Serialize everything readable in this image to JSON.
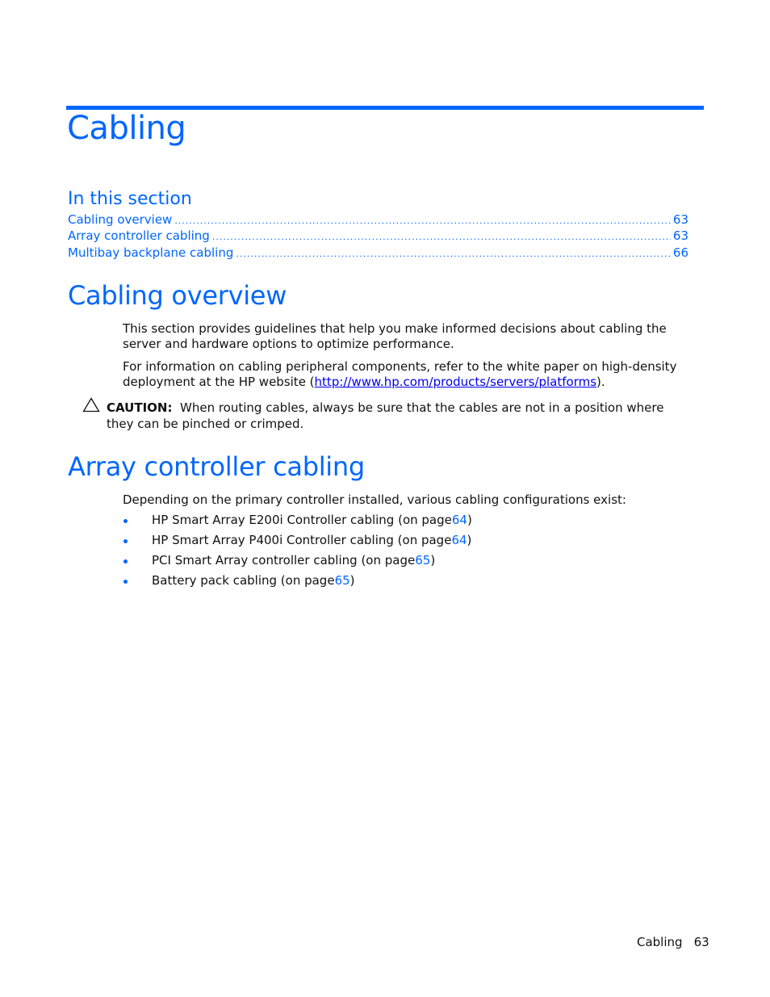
{
  "chapter": {
    "title": "Cabling"
  },
  "in_this_section": {
    "heading": "In this section",
    "entries": [
      {
        "label": "Cabling overview",
        "page": "63"
      },
      {
        "label": "Array controller cabling",
        "page": "63"
      },
      {
        "label": "Multibay backplane cabling",
        "page": "66"
      }
    ]
  },
  "cabling_overview": {
    "heading": "Cabling overview",
    "para1": "This section provides guidelines that help you make informed decisions about cabling the server and hardware options to optimize performance.",
    "para2_before": "For information on cabling peripheral components, refer to the white paper on high-density deployment at the HP website (",
    "para2_link": "http://www.hp.com/products/servers/platforms",
    "para2_after": ").",
    "caution_label": "CAUTION:",
    "caution_text": "When routing cables, always be sure that the cables are not in a position where they can be pinched or crimped."
  },
  "array_controller_cabling": {
    "heading": "Array controller cabling",
    "intro": "Depending on the primary controller installed, various cabling configurations exist:",
    "items": [
      {
        "text": "HP Smart Array E200i Controller cabling (on page ",
        "page": "64",
        "close": ")"
      },
      {
        "text": "HP Smart Array P400i Controller cabling (on page ",
        "page": "64",
        "close": ")"
      },
      {
        "text": "PCI Smart Array controller cabling (on page ",
        "page": "65",
        "close": ")"
      },
      {
        "text": "Battery pack cabling (on page ",
        "page": "65",
        "close": ")"
      }
    ]
  },
  "footer": {
    "section": "Cabling",
    "page_number": "63"
  },
  "colors": {
    "accent": "#0066ff",
    "text": "#111111"
  }
}
